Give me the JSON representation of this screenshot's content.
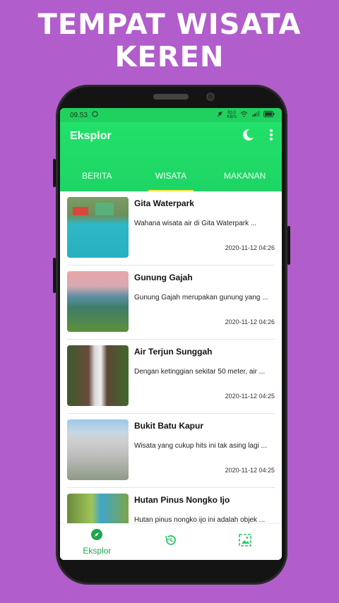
{
  "promo": {
    "line1": "TEMPAT WISATA",
    "line2": "KEREN"
  },
  "status": {
    "time": "09.53",
    "net": "83,0",
    "net_unit": "KB/S"
  },
  "appbar": {
    "title": "Eksplor"
  },
  "tabs": [
    {
      "label": "BERITA"
    },
    {
      "label": "WISATA"
    },
    {
      "label": "MAKANAN"
    }
  ],
  "items": [
    {
      "title": "Gita Waterpark",
      "desc": "Wahana wisata air di Gita Waterpark ...",
      "date": "2020-11-12 04:26"
    },
    {
      "title": "Gunung Gajah",
      "desc": "Gunung Gajah merupakan gunung yang ...",
      "date": "2020-11-12 04:26"
    },
    {
      "title": "Air Terjun Sunggah",
      "desc": "Dengan ketinggian sekitar 50 meter, air ...",
      "date": "2020-11-12 04:25"
    },
    {
      "title": "Bukit Batu Kapur",
      "desc": "Wisata yang cukup hits ini tak asing lagi ...",
      "date": "2020-11-12 04:25"
    },
    {
      "title": "Hutan Pinus Nongko Ijo",
      "desc": "Hutan pinus nongko ijo ini adalah objek ...",
      "date": ""
    }
  ],
  "bottomnav": {
    "explore_label": "Eksplor"
  },
  "colors": {
    "accent": "#1ed565",
    "background": "#b15dcb",
    "tab_indicator": "#ffe34a"
  }
}
